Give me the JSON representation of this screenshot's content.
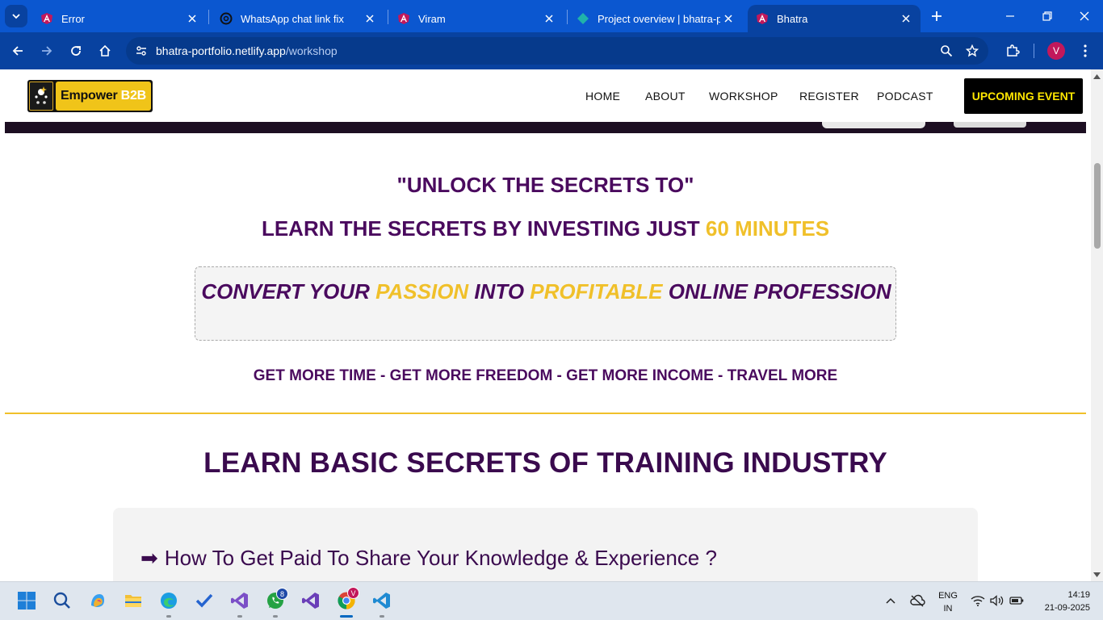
{
  "browser": {
    "tabs": [
      {
        "title": "Error",
        "icon": "angular-icon",
        "active": false
      },
      {
        "title": "WhatsApp chat link fix",
        "icon": "openai-icon",
        "active": false
      },
      {
        "title": "Viram",
        "icon": "angular-icon",
        "active": false
      },
      {
        "title": "Project overview | bhatra-po",
        "icon": "netlify-icon",
        "active": false
      },
      {
        "title": "Bhatra",
        "icon": "angular-icon",
        "active": true
      }
    ],
    "url_host": "bhatra-portfolio.netlify.app",
    "url_path": "/workshop",
    "profile_initial": "V"
  },
  "site": {
    "logo": {
      "word": "Empower",
      "suffix": "B2B"
    },
    "nav": [
      "HOME",
      "ABOUT",
      "WORKSHOP",
      "REGISTER",
      "PODCAST"
    ],
    "cta": "UPCOMING EVENT",
    "heading1": "\"UNLOCK THE SECRETS TO\"",
    "heading2": {
      "prefix": "LEARN THE SECRETS BY INVESTING JUST ",
      "highlight": "60 MINUTES"
    },
    "callout": {
      "p1": "CONVERT YOUR ",
      "h1": "PASSION",
      "p2": " INTO ",
      "h2": "PROFITABLE",
      "p3": " ONLINE PROFESSION"
    },
    "benefits": "GET MORE TIME - GET MORE FREEDOM - GET MORE INCOME - TRAVEL MORE",
    "section_title": "LEARN BASIC SECRETS OF TRAINING INDUSTRY",
    "card_item": {
      "arrow": "➡",
      "text": "How To Get Paid To Share Your Knowledge & Experience ?"
    }
  },
  "taskbar": {
    "apps": [
      "windows-start-icon",
      "search-icon",
      "copilot-icon",
      "file-explorer-icon",
      "edge-icon",
      "todo-icon",
      "visual-studio-icon",
      "whatsapp-icon",
      "visual-studio-2-icon",
      "chrome-icon",
      "vscode-icon"
    ],
    "whatsapp_badge": "8",
    "chrome_badge": "V",
    "language": "ENG",
    "region": "IN",
    "time": "14:19",
    "date": "21-09-2025"
  },
  "colors": {
    "browser_blue": "#0b57d0",
    "purple": "#4a0a5e",
    "gold": "#f0c02a",
    "cta_text": "#ffe600"
  }
}
